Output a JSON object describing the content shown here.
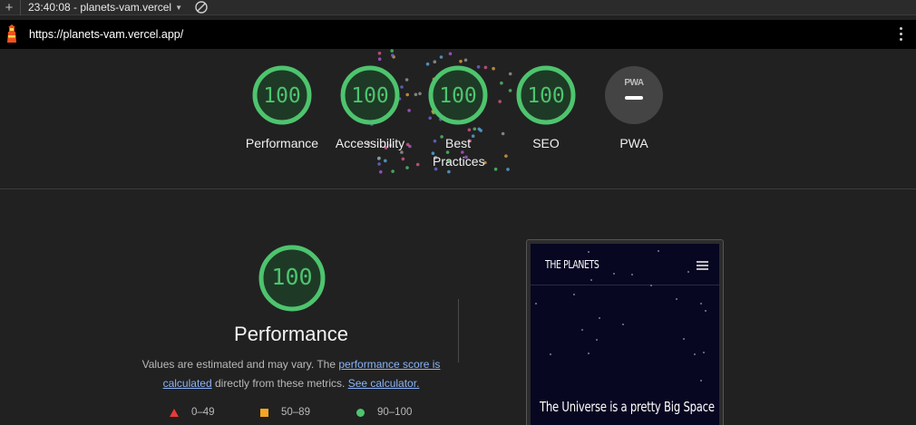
{
  "toolbar": {
    "add_label": "+",
    "report_label": "23:40:08 - planets-vam.vercel"
  },
  "urlbar": {
    "url": "https://planets-vam.vercel.app/"
  },
  "colors": {
    "pass": "#4ec46e",
    "average": "#f5a623",
    "fail": "#e83a3a",
    "background": "#212121"
  },
  "summary": {
    "gauges": [
      {
        "label": "Performance",
        "score": "100",
        "fraction": 1.0
      },
      {
        "label": "Accessibility",
        "score": "100",
        "fraction": 1.0
      },
      {
        "label": "Best Practices",
        "score": "100",
        "fraction": 1.0
      },
      {
        "label": "SEO",
        "score": "100",
        "fraction": 1.0
      }
    ],
    "pwa": {
      "label": "PWA",
      "badge_text": "PWA",
      "icon": "pwa-dash-icon"
    }
  },
  "detail": {
    "score": "100",
    "title": "Performance",
    "desc_1": "Values are estimated and may vary. The ",
    "link_1": "performance score is calculated",
    "desc_2": " directly from these metrics. ",
    "link_2": "See calculator.",
    "legend": {
      "fail_range": "0–49",
      "average_range": "50–89",
      "pass_range": "90–100"
    }
  },
  "preview": {
    "brand": "THE PLANETS",
    "headline": "The Universe is a pretty Big Space",
    "menu_icon": "hamburger-icon"
  }
}
